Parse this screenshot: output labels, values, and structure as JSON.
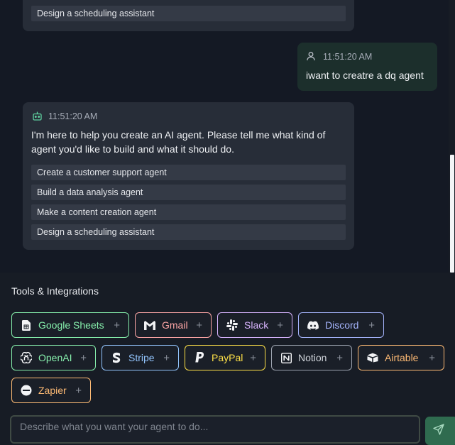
{
  "chat": {
    "top_suggestion": "Design a scheduling assistant",
    "user_message": {
      "time": "11:51:20 AM",
      "text": "iwant to creatre a dq agent"
    },
    "bot_message": {
      "time": "11:51:20 AM",
      "text": "I'm here to help you create an AI agent. Please tell me what kind of agent you'd like to build and what it should do.",
      "suggestions": [
        "Create a customer support agent",
        "Build a data analysis agent",
        "Make a content creation agent",
        "Design a scheduling assistant"
      ]
    }
  },
  "tools": {
    "title": "Tools & Integrations",
    "add_symbol": "+",
    "items": [
      {
        "label": "Google Sheets",
        "icon": "google-sheets-icon",
        "color": "#86efac"
      },
      {
        "label": "Gmail",
        "icon": "gmail-icon",
        "color": "#fca5a5"
      },
      {
        "label": "Slack",
        "icon": "slack-icon",
        "color": "#d8b4fe"
      },
      {
        "label": "Discord",
        "icon": "discord-icon",
        "color": "#a5b4fc"
      },
      {
        "label": "OpenAI",
        "icon": "openai-icon",
        "color": "#86efac"
      },
      {
        "label": "Stripe",
        "icon": "stripe-icon",
        "color": "#93c5fd"
      },
      {
        "label": "PayPal",
        "icon": "paypal-icon",
        "color": "#fde047"
      },
      {
        "label": "Notion",
        "icon": "notion-icon",
        "color": "#d1d5db"
      },
      {
        "label": "Airtable",
        "icon": "airtable-icon",
        "color": "#fdba74"
      },
      {
        "label": "Zapier",
        "icon": "zapier-icon",
        "color": "#fdba74"
      }
    ]
  },
  "composer": {
    "placeholder": "Describe what you want your agent to do...",
    "send_icon": "send-icon"
  }
}
